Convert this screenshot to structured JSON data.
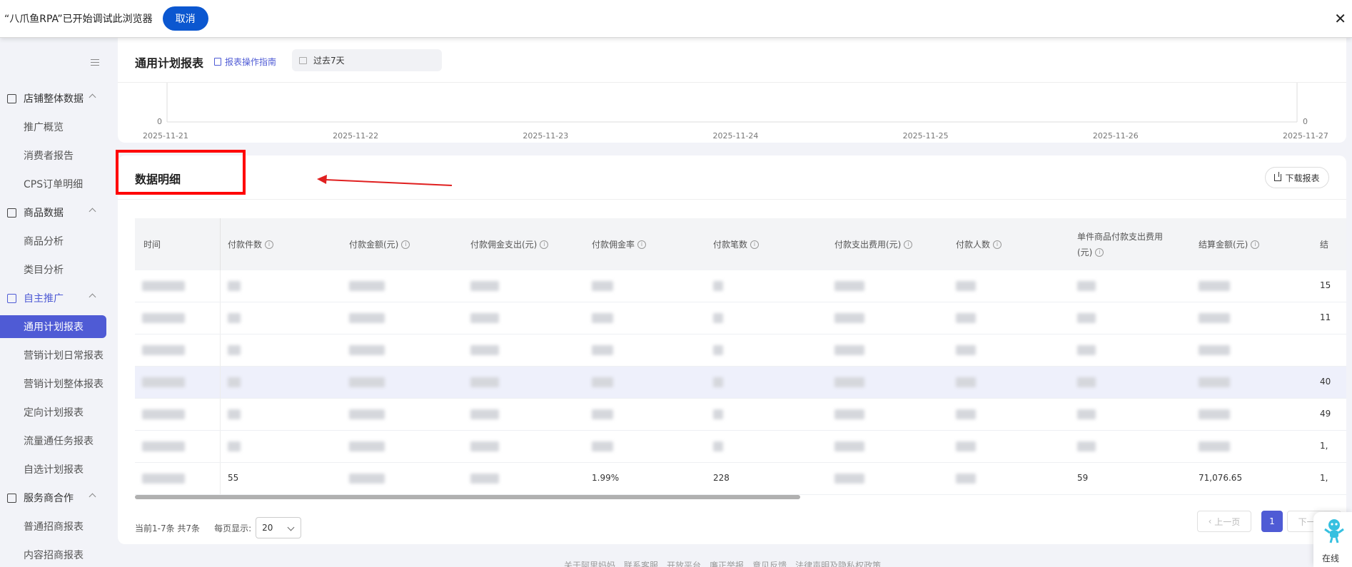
{
  "automation_bar": {
    "message": "“八爪鱼RPA”已开始调试此浏览器",
    "cancel_label": "取消",
    "close_glyph": "✕"
  },
  "sidebar": {
    "groups": [
      {
        "label": "店铺整体数据",
        "icon": "store-icon",
        "items": [
          "推广概览",
          "消费者报告",
          "CPS订单明细"
        ]
      },
      {
        "label": "商品数据",
        "icon": "product-icon",
        "items": [
          "商品分析",
          "类目分析"
        ]
      },
      {
        "label": "自主推广",
        "icon": "promotion-icon",
        "items": [
          "通用计划报表",
          "营销计划日常报表",
          "营销计划整体报表",
          "定向计划报表",
          "流量通任务报表",
          "自选计划报表"
        ]
      },
      {
        "label": "服务商合作",
        "icon": "partner-icon",
        "items": [
          "普通招商报表",
          "内容招商报表"
        ]
      }
    ],
    "active_item": "通用计划报表"
  },
  "chart_card": {
    "title": "通用计划报表",
    "guide_link": "报表操作指南",
    "date_range": "过去7天"
  },
  "chart_data": {
    "type": "line",
    "x": [
      "2025-11-21",
      "2025-11-22",
      "2025-11-23",
      "2025-11-24",
      "2025-11-25",
      "2025-11-26",
      "2025-11-27"
    ],
    "y_left_tick": "0",
    "y_right_tick": "0",
    "series": []
  },
  "detail_card": {
    "title": "数据明细",
    "download_label": "下载报表",
    "columns": [
      "时间",
      "付款件数",
      "付款金额(元)",
      "付款佣金支出(元)",
      "付款佣金率",
      "付款笔数",
      "付款支出费用(元)",
      "付款人数",
      "单件商品付款支出费用(元)",
      "结算金额(元)",
      "结"
    ],
    "rows": [
      [
        "",
        "",
        "",
        "",
        "",
        "",
        "",
        "",
        "",
        "",
        "15"
      ],
      [
        "",
        "",
        "",
        "",
        "",
        "",
        "",
        "",
        "",
        "",
        "11"
      ],
      [
        "",
        "",
        "",
        "",
        "",
        "",
        "",
        "",
        "",
        "",
        ""
      ],
      [
        "",
        "",
        "",
        "",
        "",
        "",
        "",
        "",
        "",
        "",
        "40"
      ],
      [
        "",
        "",
        "",
        "",
        "",
        "",
        "",
        "",
        "",
        "",
        "49"
      ],
      [
        "",
        "",
        "",
        "",
        "",
        "",
        "",
        "",
        "",
        "",
        "1,"
      ],
      [
        "",
        "55",
        "",
        "",
        "1.99%",
        "228",
        "",
        "",
        "59",
        "71,076.65",
        "1,"
      ]
    ]
  },
  "pagination": {
    "summary": "当前1-7条 共7条",
    "page_size_label": "每页显示:",
    "page_size": "20",
    "prev_label": "上一页",
    "current_page": "1",
    "next_label": "下一页"
  },
  "footer": {
    "links": [
      "关于阿里妈妈",
      "联系客服",
      "开放平台",
      "廉正举报",
      "意见反馈",
      "法律声明及隐私权政策"
    ]
  },
  "chat_widget": {
    "label": "在线"
  },
  "colors": {
    "accent": "#4f5bd5",
    "cancel_button": "#0b57d0",
    "annotation_red": "#ff0000"
  }
}
